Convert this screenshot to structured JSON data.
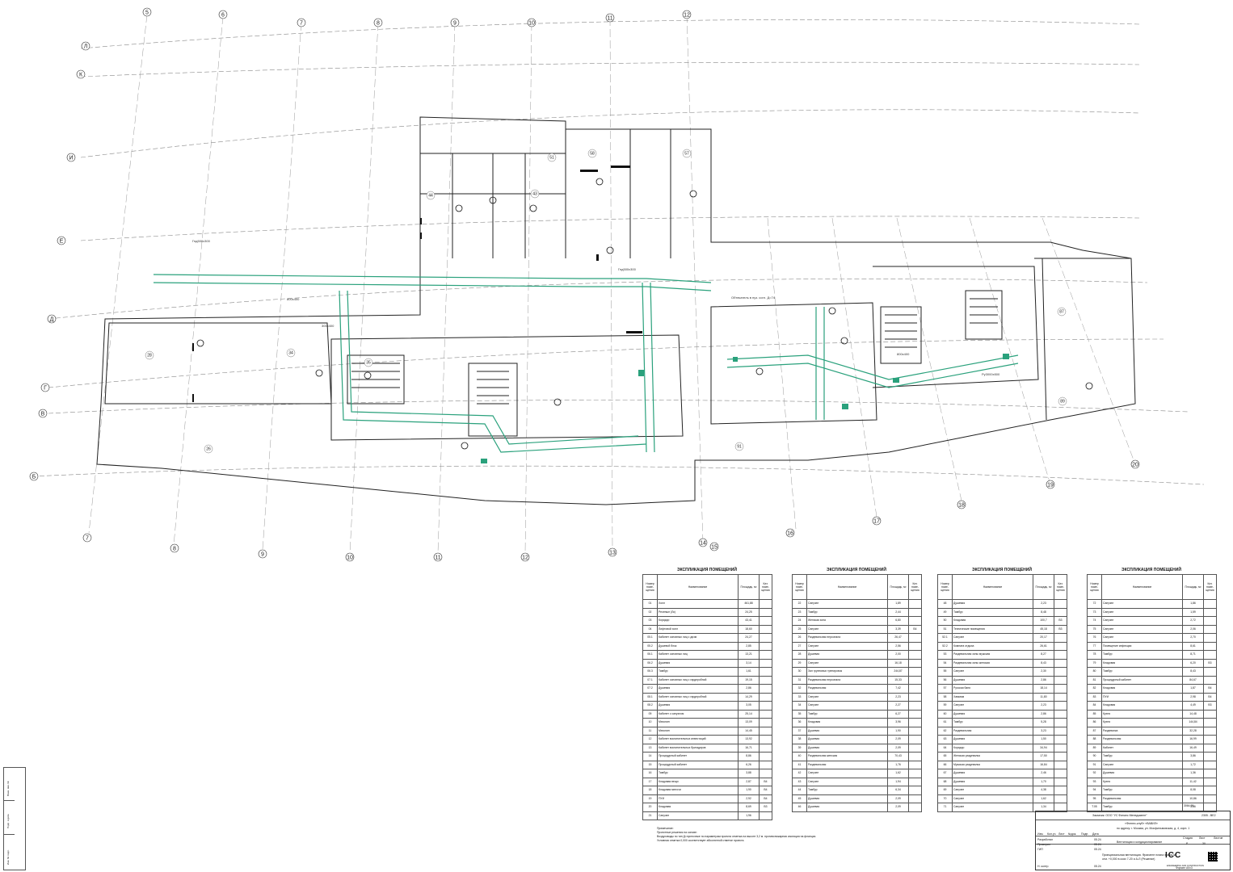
{
  "drawing": {
    "grid_axes_top": [
      "5",
      "6",
      "7",
      "8",
      "9",
      "10",
      "11",
      "12"
    ],
    "grid_axes_left": [
      "Л",
      "К",
      "И",
      "Е",
      "Д",
      "Г",
      "В",
      "Б",
      "А"
    ],
    "grid_axes_bottom": [
      "7",
      "8",
      "9",
      "10",
      "11",
      "12",
      "13",
      "14",
      "15",
      "16",
      "17",
      "18",
      "19",
      "20"
    ],
    "rooms_sample": [
      "43",
      "44",
      "45",
      "46",
      "47",
      "48",
      "49",
      "50",
      "51",
      "52",
      "53",
      "54",
      "55",
      "56",
      "57",
      "58",
      "59",
      "60",
      "61",
      "62",
      "63",
      "64",
      "65",
      "66",
      "67",
      "68",
      "69",
      "70",
      "71",
      "72",
      "73",
      "74",
      "75",
      "76",
      "77",
      "78",
      "79",
      "80",
      "81",
      "82",
      "83",
      "84",
      "85",
      "86",
      "87",
      "88",
      "89",
      "90",
      "91",
      "92",
      "93",
      "94",
      "95",
      "96",
      "97",
      "98",
      "99",
      "35",
      "36",
      "37",
      "38",
      "39",
      "40",
      "41",
      "42",
      "30",
      "31",
      "32",
      "33",
      "34",
      "24",
      "25",
      "26",
      "27",
      "28",
      "29"
    ],
    "duct_notes": [
      "Гнд500х300",
      "Обтекатель в пуз. согл. Д=74",
      "Гнд500х300",
      "800х400",
      "300х400",
      "800х400",
      "Ру3000х500"
    ]
  },
  "tables": [
    {
      "title": "ЭКСПЛИКАЦИЯ ПОМЕЩЕНИЙ",
      "headers": [
        "Номер поме-щения",
        "Наименование",
        "Площадь, м²",
        "Кат. поме-щения"
      ],
      "rows": [
        [
          "01",
          "Холл",
          "461,88",
          ""
        ],
        [
          "02",
          "Ресепшн (Лк)",
          "24,25",
          ""
        ],
        [
          "03",
          "Коридор",
          "43,41",
          ""
        ],
        [
          "04",
          "Лифтовой холл",
          "18,60",
          ""
        ],
        [
          "05.1",
          "Кабинет основных лиц с дизм",
          "24,27",
          ""
        ],
        [
          "05.2",
          "Душевой блок",
          "2,85",
          ""
        ],
        [
          "06.1",
          "Кабинет основных лиц",
          "13,21",
          ""
        ],
        [
          "06.2",
          "Душевая",
          "3,14",
          ""
        ],
        [
          "06.3",
          "Тамбур",
          "1,61",
          ""
        ],
        [
          "07.1",
          "Кабинет основных лиц с гардеробной",
          "19,15",
          ""
        ],
        [
          "07.2",
          "Душевая",
          "2,86",
          ""
        ],
        [
          "08.1",
          "Кабинет основных лиц с гардеробной",
          "14,29",
          ""
        ],
        [
          "08.2",
          "Душевая",
          "3,05",
          ""
        ],
        [
          "09",
          "Кабинет с санузлом",
          "25,14",
          ""
        ],
        [
          "10",
          "Мезонин",
          "13,09",
          ""
        ],
        [
          "11",
          "Мезонин",
          "14,45",
          ""
        ],
        [
          "12",
          "Кабинет воспитательных инвестиций",
          "13,92",
          ""
        ],
        [
          "13",
          "Кабинет воспитательных бригадиров",
          "16,71",
          ""
        ],
        [
          "14",
          "Процедурный кабинет",
          "8,86",
          ""
        ],
        [
          "15",
          "Процедурный кабинет",
          "6,26",
          ""
        ],
        [
          "16",
          "Тамбур",
          "3,88",
          ""
        ],
        [
          "17",
          "Кладовая вещи",
          "2,87",
          "В4"
        ],
        [
          "18",
          "Кладовая мелочи",
          "1,90",
          "В4"
        ],
        [
          "19",
          "ПУИ",
          "2,92",
          "В4"
        ],
        [
          "20",
          "Кладовая",
          "8,69",
          "В3"
        ],
        [
          "21",
          "Санузел",
          "1,96",
          ""
        ]
      ]
    },
    {
      "title": "ЭКСПЛИКАЦИЯ ПОМЕЩЕНИЙ",
      "headers": [
        "Номер поме-щения",
        "Наименование",
        "Площадь, м²",
        "Кат. поме-щения"
      ],
      "rows": [
        [
          "22",
          "Санузел",
          "1,89",
          ""
        ],
        [
          "23",
          "Тамбур",
          "2,44",
          ""
        ],
        [
          "24",
          "Женская зона",
          "6,80",
          ""
        ],
        [
          "25",
          "Санузел",
          "3,39",
          "В4"
        ],
        [
          "26",
          "Раздевальная персонала",
          "26,47",
          ""
        ],
        [
          "27",
          "Санузел",
          "2,56",
          ""
        ],
        [
          "28",
          "Душевая",
          "2,00",
          ""
        ],
        [
          "29",
          "Санузел",
          "16,18",
          ""
        ],
        [
          "30",
          "Зал групповых тренировок",
          "244,87",
          ""
        ],
        [
          "31",
          "Раздевальная персонала",
          "15,33",
          ""
        ],
        [
          "32",
          "Раздевальная",
          "7,42",
          ""
        ],
        [
          "33",
          "Санузел",
          "2,23",
          ""
        ],
        [
          "34",
          "Санузел",
          "2,27",
          ""
        ],
        [
          "35",
          "Тамбур",
          "6,27",
          ""
        ],
        [
          "36",
          "Кладовая",
          "3,96",
          ""
        ],
        [
          "37",
          "Душевая",
          "1,90",
          ""
        ],
        [
          "38",
          "Душевая",
          "2,09",
          ""
        ],
        [
          "39",
          "Душевая",
          "2,09",
          ""
        ],
        [
          "40",
          "Раздевальная женская",
          "70,43",
          ""
        ],
        [
          "41",
          "Раздевальная",
          "1,76",
          ""
        ],
        [
          "42",
          "Санузел",
          "1,62",
          ""
        ],
        [
          "43",
          "Санузел",
          "1,94",
          ""
        ],
        [
          "44",
          "Тамбур",
          "6,34",
          ""
        ],
        [
          "45",
          "Душевая",
          "2,09",
          ""
        ],
        [
          "46",
          "Душевая",
          "2,09",
          ""
        ]
      ]
    },
    {
      "title": "ЭКСПЛИКАЦИЯ ПОМЕЩЕНИЙ",
      "headers": [
        "Номер поме-щения",
        "Наименование",
        "Площадь, м²",
        "Кат. поме-щения"
      ],
      "rows": [
        [
          "48",
          "Душевая",
          "2,23",
          ""
        ],
        [
          "49",
          "Тамбур",
          "8,48",
          ""
        ],
        [
          "50",
          "Кладовая",
          "100,7",
          "В3"
        ],
        [
          "51",
          "Технические помещения",
          "45,18",
          "В3"
        ],
        [
          "52.1",
          "Санузел",
          "20,17",
          ""
        ],
        [
          "52.2",
          "Комната отдыха",
          "26,61",
          ""
        ],
        [
          "53",
          "Раздевальная зоны мужская",
          "8,27",
          ""
        ],
        [
          "54",
          "Раздевальная зоны женская",
          "8,43",
          ""
        ],
        [
          "55",
          "Санузел",
          "2,30",
          ""
        ],
        [
          "56",
          "Душевая",
          "2,86",
          ""
        ],
        [
          "57",
          "Русская баня",
          "18,14",
          ""
        ],
        [
          "58",
          "Хаммам",
          "11,80",
          ""
        ],
        [
          "59",
          "Санузел",
          "2,23",
          ""
        ],
        [
          "60",
          "Душевая",
          "2,86",
          ""
        ],
        [
          "61",
          "Тамбур",
          "5,28",
          ""
        ],
        [
          "62",
          "Раздевальная",
          "3,23",
          ""
        ],
        [
          "63",
          "Душевая",
          "1,50",
          ""
        ],
        [
          "64",
          "Коридор",
          "34,94",
          ""
        ],
        [
          "65",
          "Женская раздевалка",
          "17,50",
          ""
        ],
        [
          "66",
          "Мужская раздевалка",
          "16,84",
          ""
        ],
        [
          "67",
          "Душевая",
          "2,46",
          ""
        ],
        [
          "68",
          "Душевая",
          "1,70",
          ""
        ],
        [
          "69",
          "Санузел",
          "4,38",
          ""
        ],
        [
          "70",
          "Санузел",
          "1,62",
          ""
        ],
        [
          "71",
          "Санузел",
          "1,34",
          ""
        ]
      ]
    },
    {
      "title": "ЭКСПЛИКАЦИЯ ПОМЕЩЕНИЙ",
      "headers": [
        "Номер поме-щения",
        "Наименование",
        "Площадь, м²",
        "Кат. поме-щения"
      ],
      "rows": [
        [
          "72",
          "Санузел",
          "1,86",
          ""
        ],
        [
          "73",
          "Санузел",
          "1,59",
          ""
        ],
        [
          "74",
          "Санузел",
          "2,72",
          ""
        ],
        [
          "75",
          "Санузел",
          "2,06",
          ""
        ],
        [
          "76",
          "Санузел",
          "2,70",
          ""
        ],
        [
          "77",
          "Помещение инфекции",
          "8,61",
          ""
        ],
        [
          "78",
          "Тамбур",
          "8,71",
          ""
        ],
        [
          "79",
          "Кладовая",
          "6,20",
          "В3"
        ],
        [
          "80",
          "Тамбур",
          "8,43",
          ""
        ],
        [
          "81",
          "Процедурный кабинет",
          "84,67",
          ""
        ],
        [
          "82",
          "Кладовая",
          "1,87",
          "В4"
        ],
        [
          "83",
          "ПУИ",
          "2,98",
          "В4"
        ],
        [
          "84",
          "Кладовая",
          "4,49",
          "В3"
        ],
        [
          "85",
          "Кухня",
          "14,48",
          ""
        ],
        [
          "86",
          "Кухня",
          "144,84",
          ""
        ],
        [
          "87",
          "Раздевалка",
          "32,28",
          ""
        ],
        [
          "88",
          "Раздевальная",
          "16,99",
          ""
        ],
        [
          "89",
          "Кабинет",
          "16,49",
          ""
        ],
        [
          "90",
          "Тамбур",
          "3,86",
          ""
        ],
        [
          "91",
          "Санузел",
          "1,72",
          ""
        ],
        [
          "92",
          "Душевая",
          "1,36",
          ""
        ],
        [
          "93",
          "Кухня",
          "11,42",
          ""
        ],
        [
          "94",
          "Тамбур",
          "8,08",
          ""
        ],
        [
          "95",
          "Раздевальная",
          "10,86",
          ""
        ],
        [
          "Т.05",
          "Тамбур",
          "3,86",
          ""
        ]
      ],
      "total": "3064,99"
    }
  ],
  "notes": {
    "heading": "Примечание:",
    "lines": [
      "Проектные решения на основе:",
      "Воздуховоды по тип Д=приточные по параметрам проекта отметка на высоте 3,2 м. противопожарная изоляция на фланцах.",
      "Условная отметка 0,000 соответствует абсолютной отметке проекта."
    ]
  },
  "stamp": {
    "customer": "Заказчик: ООО \"УС Финанс Менеджмент\"",
    "code": "2305 - ВЕ2",
    "object": "«Фитнес-клуб» «ВАВИЛ»",
    "address": "по адресу: г. Москва, ул. Мосфильмовская, д. 4, корп. 1",
    "section": "Вентиляция и кондиционирование",
    "stage_label": "Стадия",
    "sheet_label": "Лист",
    "sheets_label": "Листов",
    "stage": "Р",
    "sheet": "30",
    "sheets": "",
    "title": "Принципиальная вентиляция. Фрагмент плана этажа на отм. +0,000 в осях 7-20 и А-Л (Решение)",
    "roles": [
      "Разработал",
      "Проверил",
      "ГИП",
      "Н. контр."
    ],
    "dates": [
      "05.24",
      "05.24",
      "05.24",
      "05.24"
    ],
    "format": "Формат А0х3",
    "cols": [
      "Изм.",
      "Кол.уч.",
      "Лист",
      "№док.",
      "Подп.",
      "Дата"
    ],
    "logo": "ICC",
    "logo_sub": "ENGINEERING AND CONSTRUCTION"
  },
  "side_strip": [
    "Взам. инв. №",
    "Подп. и дата",
    "Инв. № подл."
  ],
  "colors": {
    "duct": "#2aa17c",
    "line": "#222222",
    "axis": "#555555"
  }
}
